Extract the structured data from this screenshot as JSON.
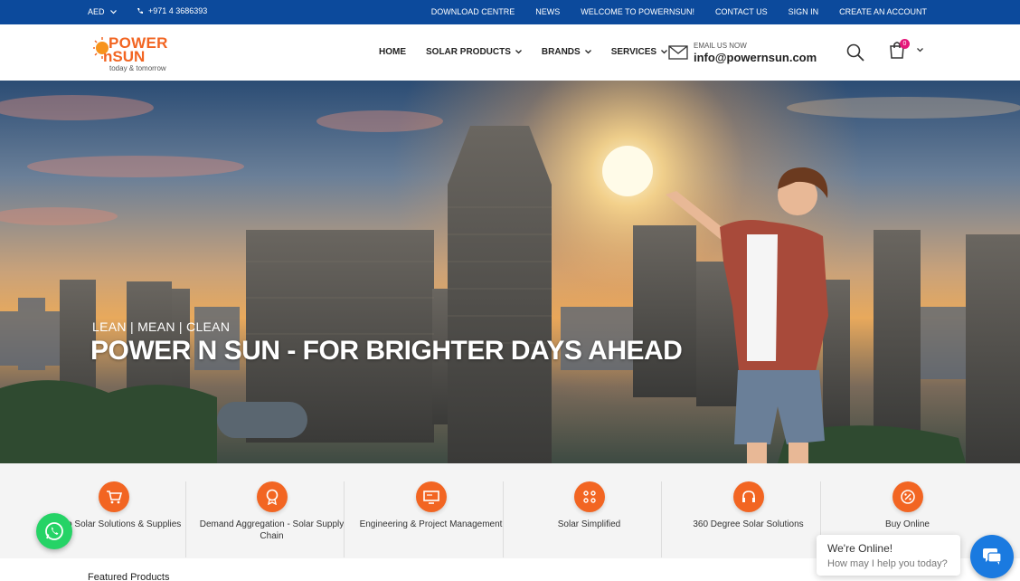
{
  "topbar": {
    "currency": "AED",
    "phone": "+971 4 3686393",
    "links": [
      "DOWNLOAD CENTRE",
      "NEWS",
      "WELCOME TO POWERNSUN!",
      "CONTACT US",
      "SIGN IN",
      "CREATE AN ACCOUNT"
    ]
  },
  "logo": {
    "line1": "POWER",
    "line2_a": "nSUN",
    "tagline": "today & tomorrow"
  },
  "nav": {
    "home": "HOME",
    "solar_products": "SOLAR PRODUCTS",
    "brands": "BRANDS",
    "services": "SERVICES"
  },
  "email": {
    "label": "EMAIL US NOW",
    "address": "info@powernsun.com"
  },
  "cart": {
    "count": "0"
  },
  "hero": {
    "tagline": "LEAN | MEAN | CLEAN",
    "headline": "POWER N SUN - FOR BRIGHTER DAYS AHEAD"
  },
  "services": [
    {
      "label": "e Stop Solar Solutions & Supplies",
      "icon": "cart-icon"
    },
    {
      "label": "Demand Aggregation - Solar Supply Chain",
      "icon": "badge-icon"
    },
    {
      "label": "Engineering & Project Management",
      "icon": "monitor-icon"
    },
    {
      "label": "Solar Simplified",
      "icon": "grid-icon"
    },
    {
      "label": "360 Degree Solar Solutions",
      "icon": "headset-icon"
    },
    {
      "label": "Buy Online",
      "icon": "percent-icon"
    }
  ],
  "featured_title": "Featured Products",
  "chat": {
    "title": "We're Online!",
    "subtitle": "How may I help you today?"
  },
  "colors": {
    "topbar": "#0c4a9c",
    "accent": "#f26522",
    "badge": "#e4187a",
    "whatsapp": "#25d366",
    "chat": "#1a7ae0"
  }
}
